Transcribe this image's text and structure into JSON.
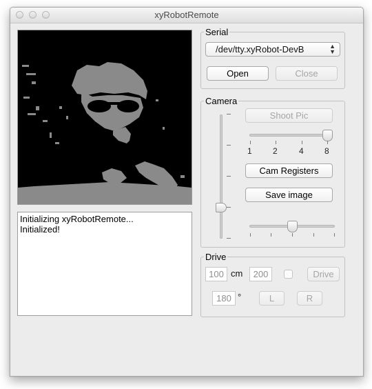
{
  "window": {
    "title": "xyRobotRemote"
  },
  "log": {
    "lines": [
      "Initializing xyRobotRemote...",
      "Initialized!"
    ]
  },
  "serial": {
    "legend": "Serial",
    "port_selected": "/dev/tty.xyRobot-DevB",
    "open_label": "Open",
    "close_label": "Close"
  },
  "camera": {
    "legend": "Camera",
    "shoot_label": "Shoot Pic",
    "scale_ticks": [
      "1",
      "2",
      "4",
      "8"
    ],
    "scale_value": "8",
    "registers_label": "Cam Registers",
    "save_label": "Save image",
    "vertical_slider_level": 0.23,
    "horizontal_slider_level": 0.5
  },
  "drive": {
    "legend": "Drive",
    "distance_value": "100",
    "distance_unit": "cm",
    "speed_value": "200",
    "drive_label": "Drive",
    "angle_value": "180",
    "angle_unit": "°",
    "left_label": "L",
    "right_label": "R"
  }
}
